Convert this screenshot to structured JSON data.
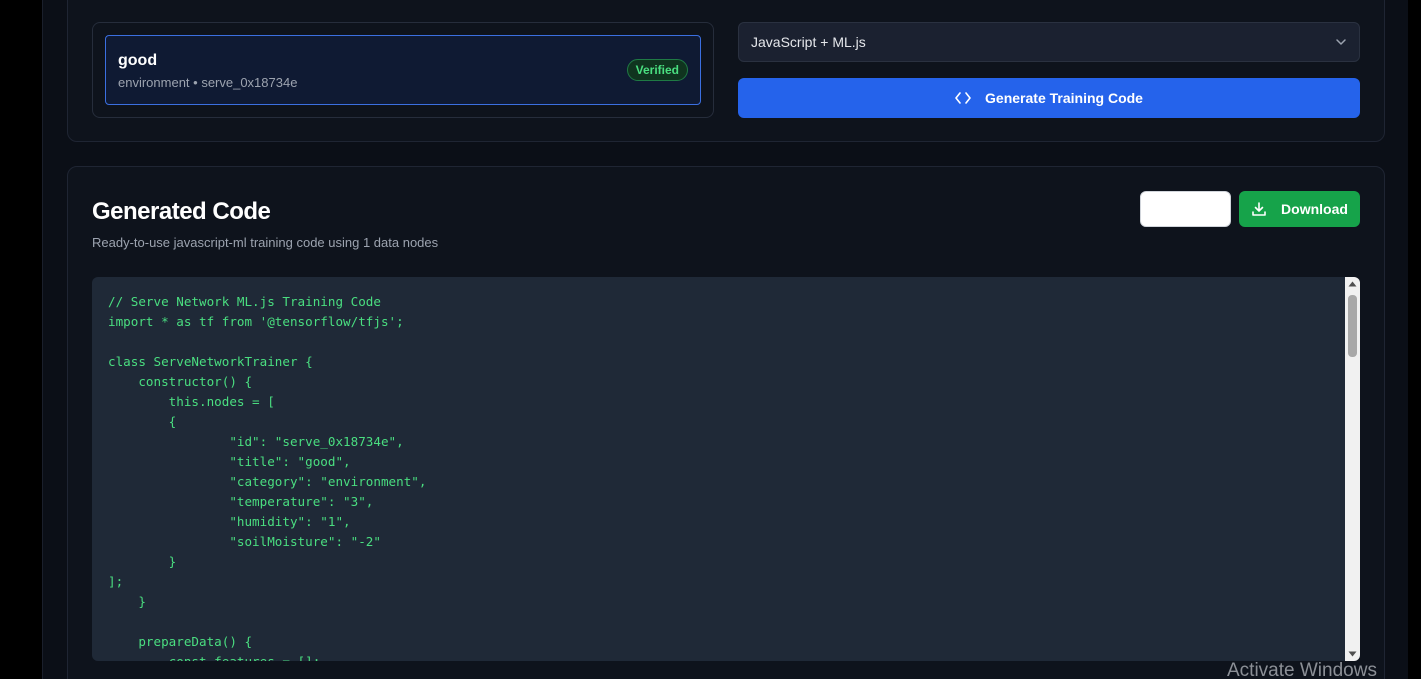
{
  "nodes_panel": {
    "items": [
      {
        "title": "good",
        "subtitle": "environment • serve_0x18734e",
        "badge": "Verified"
      }
    ]
  },
  "config": {
    "language_select": {
      "selected": "JavaScript + ML.js"
    },
    "generate_label": "Generate Training Code"
  },
  "output": {
    "title": "Generated Code",
    "description": "Ready-to-use javascript-ml training code using 1 data nodes",
    "download_label": "Download",
    "code": "// Serve Network ML.js Training Code\nimport * as tf from '@tensorflow/tfjs';\n\nclass ServeNetworkTrainer {\n    constructor() {\n        this.nodes = [\n        {\n                \"id\": \"serve_0x18734e\",\n                \"title\": \"good\",\n                \"category\": \"environment\",\n                \"temperature\": \"3\",\n                \"humidity\": \"1\",\n                \"soilMoisture\": \"-2\"\n        }\n];\n    }\n\n    prepareData() {\n        const features = [];"
  },
  "os_watermark": "Activate Windows",
  "colors": {
    "primary": "#2563eb",
    "success": "#16a34a",
    "code_text": "#4ade80",
    "code_bg": "#1f2937"
  },
  "icons": {
    "select": "chevron-down-icon",
    "generate": "code-brackets-icon",
    "download": "download-icon"
  }
}
